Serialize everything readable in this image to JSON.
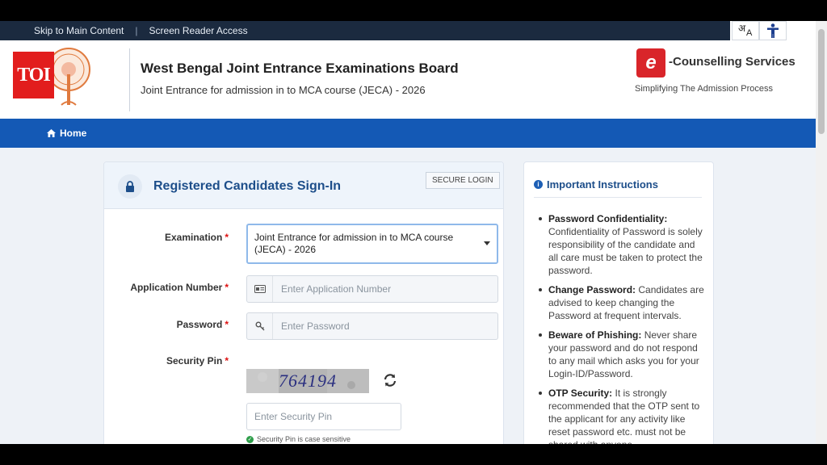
{
  "topbar": {
    "skip_link": "Skip to Main Content",
    "separator": "|",
    "reader_link": "Screen Reader Access",
    "lang_glyph_1": "अ",
    "lang_glyph_2": "A"
  },
  "watermark": {
    "text": "TOI"
  },
  "header": {
    "title": "West Bengal Joint Entrance Examinations Board",
    "subtitle": "Joint Entrance for admission in to MCA course (JECA) - 2026",
    "ec_letter": "e",
    "ec_title": "-Counselling Services",
    "ec_tagline": "Simplifying The Admission Process"
  },
  "nav": {
    "home": "Home"
  },
  "login": {
    "title": "Registered Candidates Sign-In",
    "badge": "SECURE LOGIN",
    "exam_label": "Examination",
    "exam_value": "Joint Entrance for admission in to MCA course (JECA) - 2026",
    "app_label": "Application Number",
    "app_placeholder": "Enter Application Number",
    "pwd_label": "Password",
    "pwd_placeholder": "Enter Password",
    "pin_label": "Security Pin",
    "captcha": "764194",
    "pin_placeholder": "Enter Security Pin",
    "pin_hint": "Security Pin is case sensitive",
    "required_mark": "*"
  },
  "instructions": {
    "title": "Important Instructions",
    "items": [
      {
        "heading": "Password Confidentiality:",
        "text": "Confidentiality of Password is solely responsibility of the candidate and all care must be taken to protect the password."
      },
      {
        "heading": "Change Password:",
        "text": "Candidates are advised to keep changing the Password at frequent intervals."
      },
      {
        "heading": "Beware of Phishing:",
        "text": "Never share your password and do not respond to any mail which asks you for your Login-ID/Password."
      },
      {
        "heading": "OTP Security:",
        "text": "It is strongly recommended that the OTP sent to the applicant for any activity like reset password etc. must not be shared with anyone."
      }
    ]
  },
  "colors": {
    "nav_blue": "#1459b5",
    "title_blue": "#1d4e8a",
    "required_red": "#dd1111",
    "toi_red": "#e21d1d"
  }
}
